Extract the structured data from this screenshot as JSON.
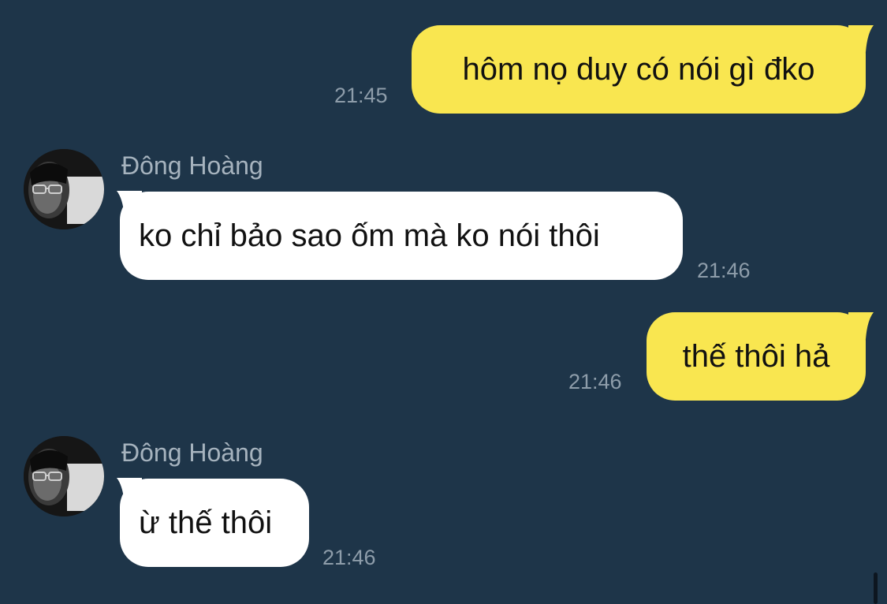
{
  "messages": [
    {
      "direction": "outgoing",
      "text": "hôm nọ duy có nói gì đko",
      "time": "21:45"
    },
    {
      "direction": "incoming",
      "sender": "Đông Hoàng",
      "text": "ko chỉ bảo sao ốm mà ko nói thôi",
      "time": "21:46"
    },
    {
      "direction": "outgoing",
      "text": "thế thôi hả",
      "time": "21:46"
    },
    {
      "direction": "incoming",
      "sender": "Đông Hoàng",
      "text": "ừ thế thôi",
      "time": "21:46"
    }
  ],
  "colors": {
    "background": "#1e3549",
    "outgoing_bubble": "#f9e650",
    "incoming_bubble": "#ffffff",
    "timestamp": "#8e9daa",
    "sender_name": "#a6b3be"
  },
  "icons": {
    "avatar": "user-avatar-photo"
  }
}
